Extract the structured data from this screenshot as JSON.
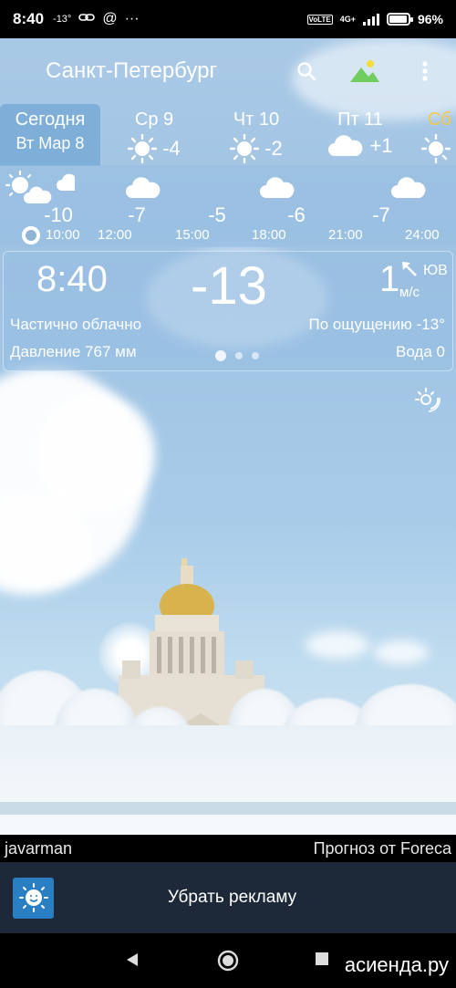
{
  "status_bar": {
    "time": "8:40",
    "temp_small": "-13°",
    "more": "···",
    "net_label": "VoLTE",
    "net_gen": "4G+",
    "battery": "96%"
  },
  "header": {
    "city": "Санкт-Петербург"
  },
  "days": [
    {
      "name": "Сегодня",
      "sub": "Вт Мар 8",
      "active": true
    },
    {
      "name": "Ср 9",
      "temp": "-4",
      "icon": "sun-icon"
    },
    {
      "name": "Чт 10",
      "temp": "-2",
      "icon": "sun-icon"
    },
    {
      "name": "Пт 11",
      "temp": "+1",
      "icon": "cloud-icon"
    },
    {
      "name": "Сб",
      "icon": "sun-icon"
    }
  ],
  "hourly": [
    {
      "time": "10:00",
      "temp": "-10",
      "icon": "partly-cloudy-icon"
    },
    {
      "time": "12:00",
      "temp": "-7",
      "icon": "cloud-icon"
    },
    {
      "time": "15:00",
      "temp": "-5",
      "icon": "none"
    },
    {
      "time": "18:00",
      "temp": "-6",
      "icon": "cloud-icon"
    },
    {
      "time": "21:00",
      "temp": "-7",
      "icon": "none"
    },
    {
      "time": "24:00",
      "temp": "",
      "icon": "cloud-icon"
    }
  ],
  "current": {
    "time": "8:40",
    "temp": "-13",
    "wind_speed": "1",
    "wind_dir": "ЮВ",
    "wind_unit": "м/с",
    "condition": "Частично облачно",
    "feels_like": "По ощущению -13°",
    "pressure": "Давление 767 мм",
    "precip": "Вода 0"
  },
  "credits": {
    "author": "javarman",
    "provider": "Прогноз от Foreca"
  },
  "ad": {
    "label": "Убрать рекламу"
  },
  "watermark": "асиенда.ру",
  "colors": {
    "accent": "#2a7fc2",
    "ad_bg": "#1d2838",
    "active_day": "#78aad7",
    "sky": "#a9c9e6"
  }
}
